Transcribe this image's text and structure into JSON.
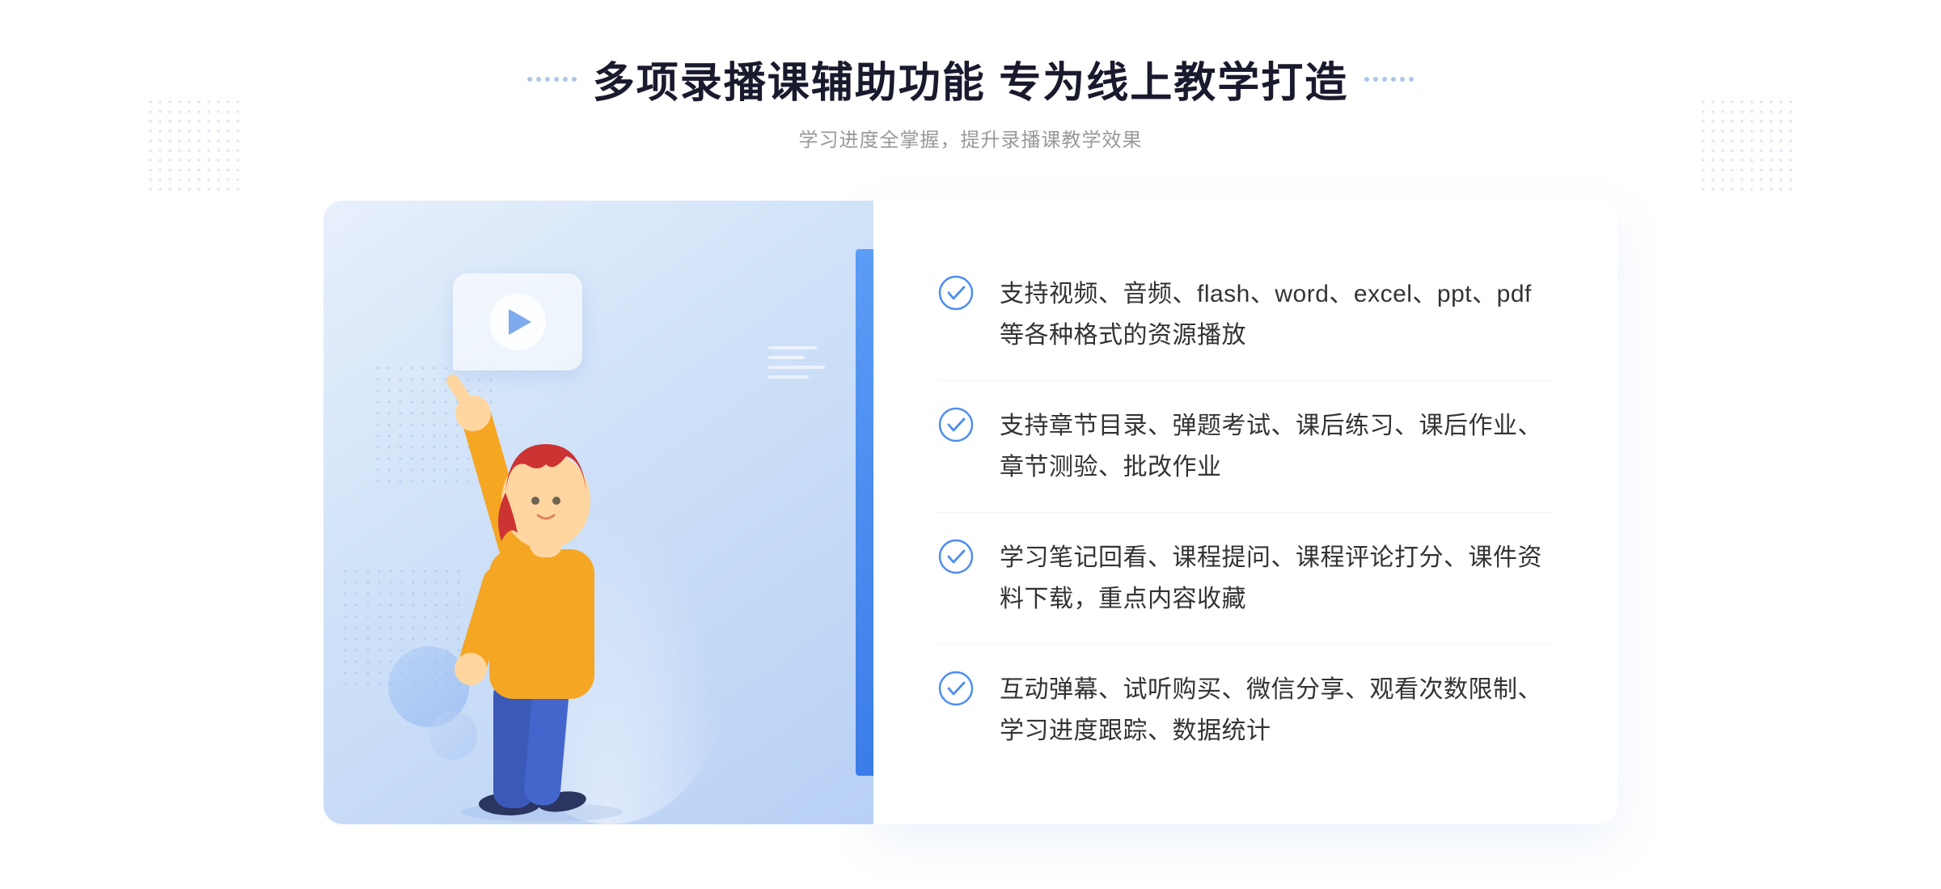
{
  "header": {
    "title": "多项录播课辅助功能 专为线上教学打造",
    "subtitle": "学习进度全掌握，提升录播课教学效果",
    "decorator_left": "❖",
    "decorator_right": "❖"
  },
  "features": [
    {
      "id": 1,
      "text": "支持视频、音频、flash、word、excel、ppt、pdf等各种格式的资源播放"
    },
    {
      "id": 2,
      "text": "支持章节目录、弹题考试、课后练习、课后作业、章节测验、批改作业"
    },
    {
      "id": 3,
      "text": "学习笔记回看、课程提问、课程评论打分、课件资料下载，重点内容收藏"
    },
    {
      "id": 4,
      "text": "互动弹幕、试听购买、微信分享、观看次数限制、学习进度跟踪、数据统计"
    }
  ],
  "colors": {
    "accent": "#4d8ef0",
    "title": "#1a1a2e",
    "subtitle": "#999",
    "feature_text": "#333",
    "check_color": "#4d8ef0",
    "bg_gradient_start": "#e8f0fb",
    "bg_gradient_end": "#b8d0f5"
  }
}
